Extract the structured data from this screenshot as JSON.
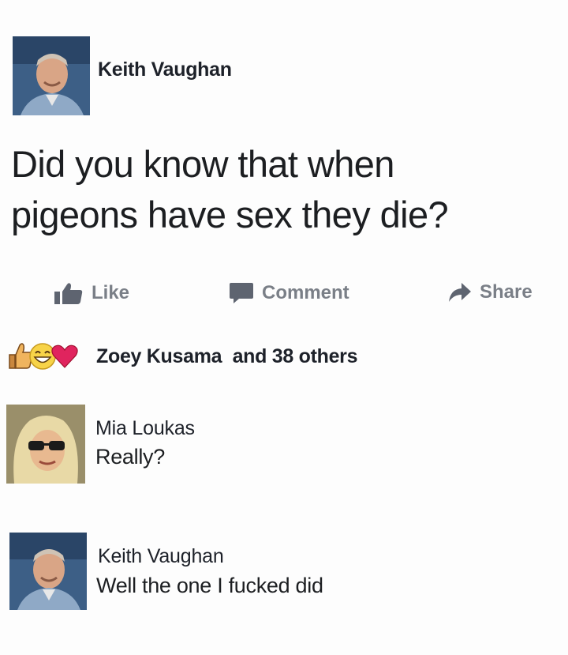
{
  "post": {
    "author": "Keith Vaughan",
    "text_line1": "Did you know that when",
    "text_line2": "pigeons have sex they die?"
  },
  "actions": {
    "like": "Like",
    "comment": "Comment",
    "share": "Share"
  },
  "reactions": {
    "icons": [
      "thumbs-up-icon",
      "grin-icon",
      "heart-icon"
    ],
    "name": "Zoey Kusama",
    "others": "and 38 others"
  },
  "comments": [
    {
      "author": "Mia Loukas",
      "text": "Really?"
    },
    {
      "author": "Keith Vaughan",
      "text": "Well the one I fucked did"
    }
  ],
  "colors": {
    "like_blue": "#5890ff",
    "heart_red": "#e0245e",
    "grin_yellow": "#f7d348",
    "action_gray": "#7a7f87"
  }
}
